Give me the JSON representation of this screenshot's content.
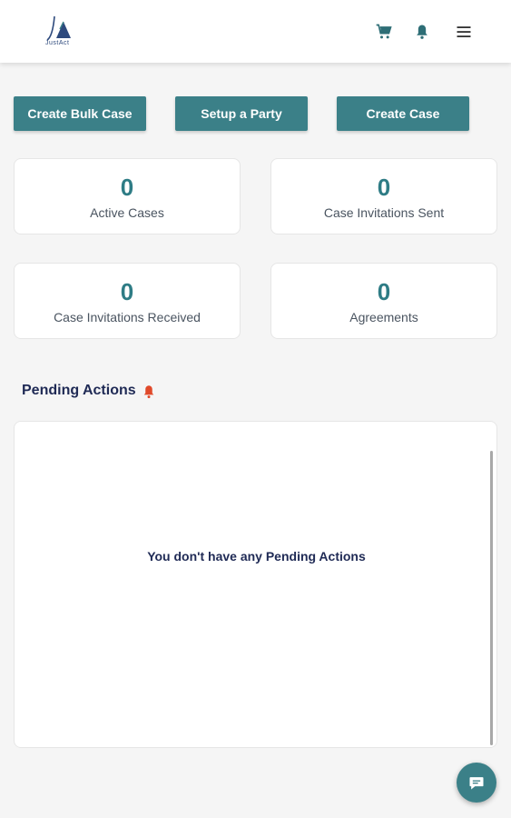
{
  "header": {
    "logo_text": "JustAct",
    "icons": [
      "cart-icon",
      "bell-icon",
      "hamburger-menu-icon"
    ]
  },
  "actions": {
    "create_bulk_case": "Create Bulk Case",
    "setup_party": "Setup a Party",
    "create_case": "Create Case"
  },
  "stats": [
    {
      "value": "0",
      "label": "Active Cases"
    },
    {
      "value": "0",
      "label": "Case Invitations Sent"
    },
    {
      "value": "0",
      "label": "Case Invitations Received"
    },
    {
      "value": "0",
      "label": "Agreements"
    }
  ],
  "pending": {
    "title": "Pending Actions",
    "empty_message": "You don't have any Pending Actions"
  },
  "colors": {
    "accent": "#3b8088",
    "stat_number": "#2e7c85",
    "heading": "#1f2a55",
    "alert": "#e0492a"
  }
}
